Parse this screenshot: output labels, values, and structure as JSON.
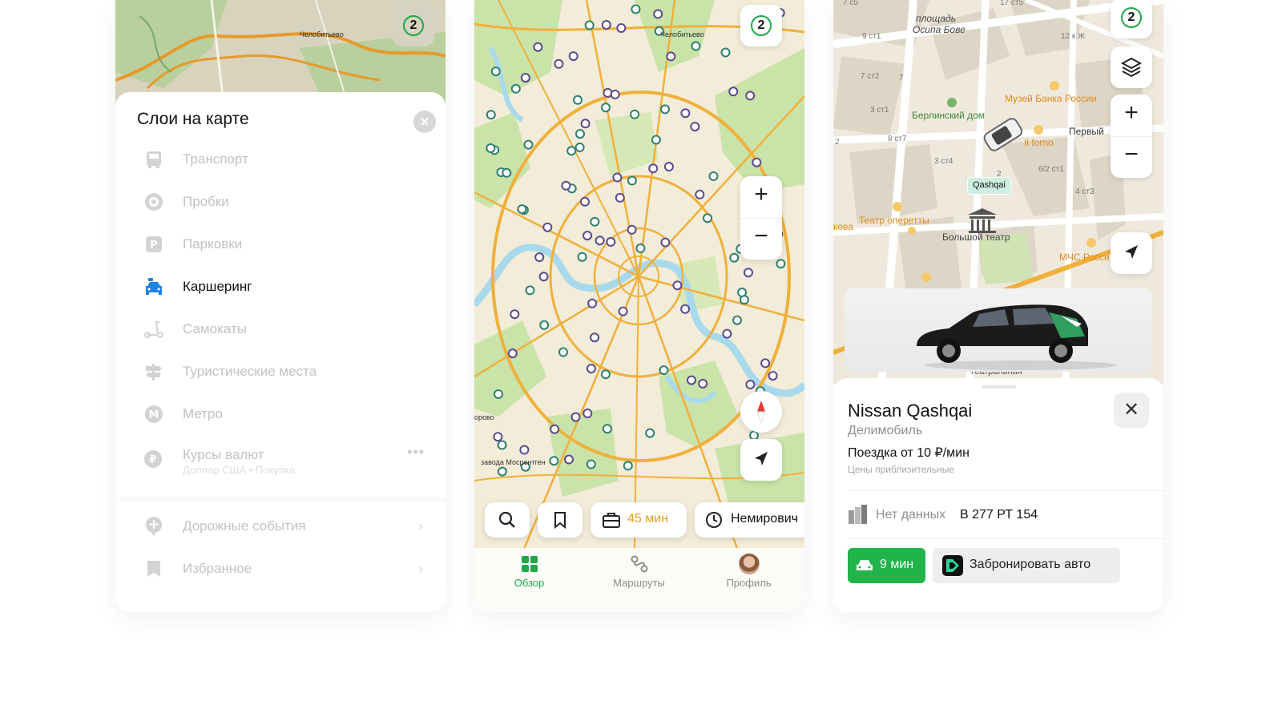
{
  "colors": {
    "accent_green": "#1fa84a",
    "cta_green": "#20b44b",
    "orange_text": "#e8a21c",
    "map_bg": "#f2ecd8",
    "park_green": "#c9e3a8",
    "road_orange": "#f0b03c",
    "water_blue": "#a9d9ec",
    "carsharing_blue": "#1d82e6",
    "pin_purple": "#5b4a8c",
    "pin_teal": "#2e7f6e"
  },
  "layers_panel": {
    "badge": "2",
    "map_label": "Челобитьево",
    "title": "Слои на карте",
    "close_icon": "close-icon",
    "items": [
      {
        "label": "Транспорт",
        "icon": "bus-icon",
        "active": false
      },
      {
        "label": "Пробки",
        "icon": "traffic-icon",
        "active": false
      },
      {
        "label": "Парковки",
        "icon": "parking-icon",
        "active": false
      },
      {
        "label": "Каршеринг",
        "icon": "carsharing-icon",
        "active": true
      },
      {
        "label": "Самокаты",
        "icon": "scooter-icon",
        "active": false
      },
      {
        "label": "Туристические места",
        "icon": "tourist-sign-icon",
        "active": false
      },
      {
        "label": "Метро",
        "icon": "metro-icon",
        "active": false
      },
      {
        "label": "Курсы валют",
        "sub_currency": "Доллар США",
        "sub_type": "Покупка",
        "icon": "currency-icon",
        "active": false
      }
    ],
    "extra_items": [
      {
        "label": "Дорожные события",
        "icon": "road-event-icon"
      },
      {
        "label": "Избранное",
        "icon": "bookmark-icon"
      }
    ]
  },
  "map_panel": {
    "badge": "2",
    "map_labels": {
      "top": "Челобитьево",
      "bottom_left": "завода Мосрентген",
      "left_edge": "орово"
    },
    "search_icon": "search-icon",
    "bookmark_icon": "bookmark-icon",
    "work_time": "45 мин",
    "work_icon": "briefcase-icon",
    "clock_place": "Немирович",
    "tabs": [
      {
        "label": "Обзор",
        "icon": "grid-icon",
        "active": true
      },
      {
        "label": "Маршруты",
        "icon": "routes-icon",
        "active": false
      },
      {
        "label": "Профиль",
        "icon": "avatar",
        "active": false
      }
    ]
  },
  "car_panel": {
    "badge": "2",
    "map_labels": {
      "square": "площадь",
      "square2": "Осипа Бове",
      "museum": "Музей Банка России",
      "berlin": "Берлинский дом",
      "il_forno": "Il forno",
      "first": "Первый",
      "operetta": "Театр оперетты",
      "bolshoi": "Большой театр",
      "mchs": "МЧС Росси",
      "teatralnaya": "Театральная",
      "kova": "кова",
      "n_cs5": "7 с5",
      "n_ct5": "17 ст5",
      "n_9ct1": "9 ст1",
      "n_12k": "12 к Ж",
      "n_7ct2": "7 ст2",
      "n_7": "7",
      "n_3ct1": "3 ст1",
      "n_8ct7": "8 ст7",
      "n_3ct4": "3 ст4",
      "n_2": "2",
      "n_62": "6/2 ст1",
      "n_4ct3": "4 ст3",
      "n_z2": "2"
    },
    "car_marker_label": "Qashqai",
    "card": {
      "name": "Nissan Qashqai",
      "company": "Делимобиль",
      "price": "Поездка от 10 ₽/мин",
      "note": "Цены приблизительные",
      "fuel_label": "Нет данных",
      "plate": "В 277 РТ 154",
      "time_button": "9 мин",
      "book_button": "Забронировать авто"
    }
  }
}
